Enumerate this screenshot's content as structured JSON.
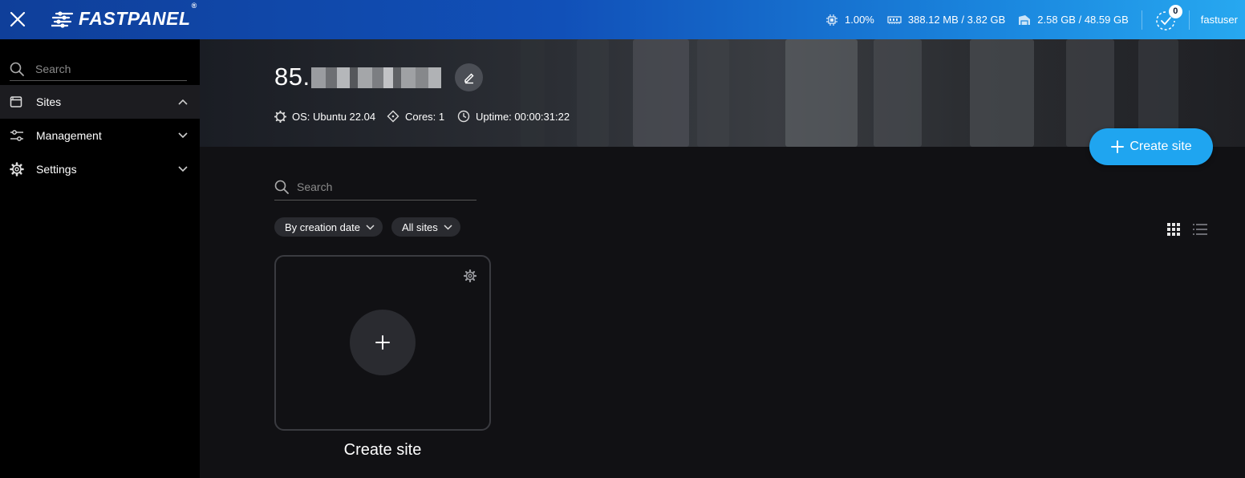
{
  "topbar": {
    "logo_text": "FASTPANEL",
    "logo_reg": "®",
    "cpu": "1.00%",
    "memory": "388.12 MB / 3.82 GB",
    "disk": "2.58 GB / 48.59 GB",
    "tasks_count": "0",
    "username": "fastuser"
  },
  "sidebar": {
    "search_placeholder": "Search",
    "items": [
      {
        "label": "Sites",
        "icon": "browser-window-icon",
        "state": "expanded"
      },
      {
        "label": "Management",
        "icon": "sliders-icon",
        "state": "collapsed"
      },
      {
        "label": "Settings",
        "icon": "gear-icon",
        "state": "collapsed"
      }
    ]
  },
  "server": {
    "ip_visible": "85.",
    "os": "OS: Ubuntu 22.04",
    "cores": "Cores: 1",
    "uptime": "Uptime: 00:00:31:22"
  },
  "main": {
    "create_site_label": "Create site",
    "search_placeholder": "Search",
    "sort_label": "By creation date",
    "filter_label": "All sites",
    "card_label": "Create site"
  },
  "colors": {
    "accent": "#1fa5f0",
    "topbar_start": "#0f3f9a",
    "topbar_end": "#27a8f0",
    "background": "#111114",
    "sidebar": "#000000"
  }
}
